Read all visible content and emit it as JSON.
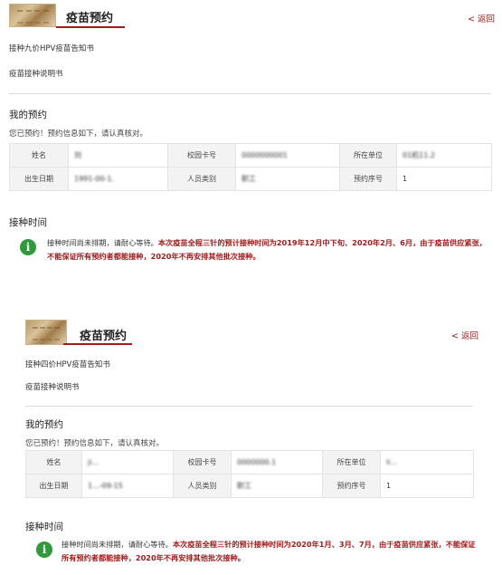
{
  "screens": [
    {
      "title": "疫苗预约",
      "back": "< 返回",
      "links": [
        "接种九价HPV疫苗告知书",
        "疫苗接种说明书"
      ],
      "my_booking": {
        "heading": "我的预约",
        "subtitle": "您已预约！预约信息如下，请认真核对。",
        "table": {
          "row1": [
            {
              "label": "姓名",
              "value": "刘"
            },
            {
              "label": "校园卡号",
              "value": "0000000001"
            },
            {
              "label": "所在单位",
              "value": "01机11.2"
            }
          ],
          "row2": [
            {
              "label": "出生日期",
              "value": "1991-00-1."
            },
            {
              "label": "人员类别",
              "value": "职工"
            },
            {
              "label": "预约序号",
              "value": "1"
            }
          ]
        }
      },
      "vaccination": {
        "heading": "接种时间",
        "normal": "接种时间尚未排期，请耐心等待。",
        "highlight": "本次疫苗全程三针的预计接种时间为2019年12月中下旬、2020年2月、6月，由于疫苗供应紧张，不能保证所有预约者都能接种，2020年不再安排其他批次接种。"
      }
    },
    {
      "title": "疫苗预约",
      "back": "< 返回",
      "links": [
        "接种四价HPV疫苗告知书",
        "疫苗接种说明书"
      ],
      "my_booking": {
        "heading": "我的预约",
        "subtitle": "您已预约！预约信息如下，请认真核对。",
        "table": {
          "row1": [
            {
              "label": "姓名",
              "value": "ji..."
            },
            {
              "label": "校园卡号",
              "value": "0000000.1"
            },
            {
              "label": "所在单位",
              "value": "li..."
            }
          ],
          "row2": [
            {
              "label": "出生日期",
              "value": "1...-09-15"
            },
            {
              "label": "人员类别",
              "value": "职工"
            },
            {
              "label": "预约序号",
              "value": "1"
            }
          ]
        }
      },
      "vaccination": {
        "heading": "接种时间",
        "normal": "接种时间尚未排期，请耐心等待。",
        "highlight": "本次疫苗全程三针的预计接种时间为2020年1月、3月、7月，由于疫苗供应紧张，不能保证所有预约者都能接种，2020年不再安排其他批次接种。"
      }
    }
  ],
  "colors": {
    "accent": "#a11b1b",
    "info_icon": "#2e9a3a",
    "label_bg": "#f3f3f3"
  },
  "icons": {
    "info": "info-icon"
  }
}
